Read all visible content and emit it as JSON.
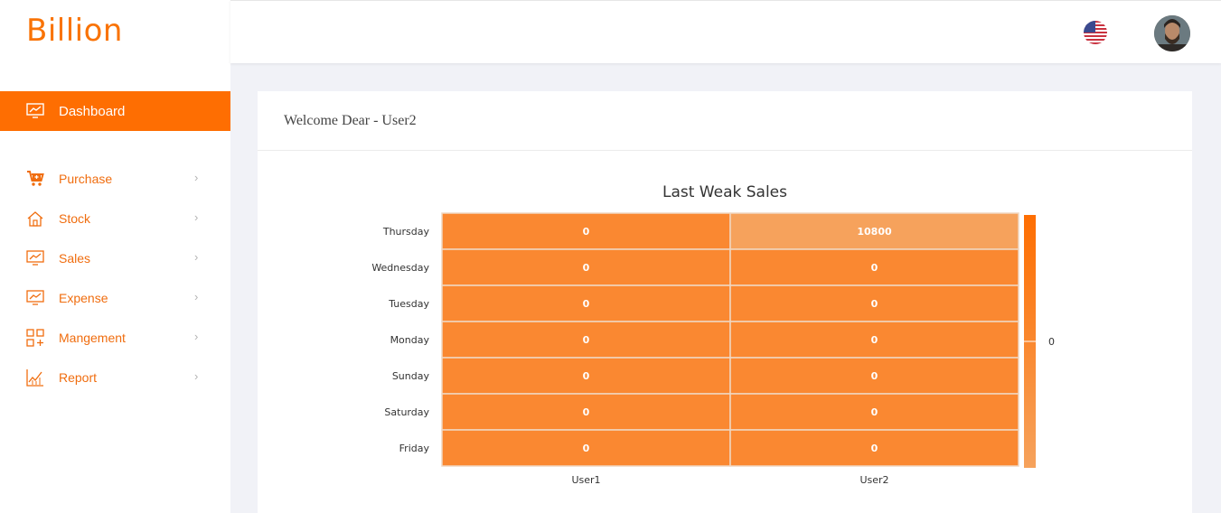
{
  "app": {
    "logo_text": "Billion",
    "brand_color": "#fe6e02"
  },
  "sidebar": {
    "active": {
      "label": "Dashboard",
      "icon": "monitor-chart-icon"
    },
    "items": [
      {
        "label": "Purchase",
        "icon": "cart-plus-icon"
      },
      {
        "label": "Stock",
        "icon": "home-icon"
      },
      {
        "label": "Sales",
        "icon": "monitor-chart-icon"
      },
      {
        "label": "Expense",
        "icon": "monitor-chart-icon"
      },
      {
        "label": "Mangement",
        "icon": "grid-plus-icon"
      },
      {
        "label": "Report",
        "icon": "line-chart-icon"
      }
    ]
  },
  "header": {
    "language_icon": "us-flag-icon",
    "avatar_icon": "user-avatar"
  },
  "card": {
    "welcome": "Welcome Dear - User2"
  },
  "chart_data": {
    "type": "heatmap",
    "title": "Last Weak Sales",
    "x": [
      "User1",
      "User2"
    ],
    "y": [
      "Thursday",
      "Wednesday",
      "Tuesday",
      "Monday",
      "Sunday",
      "Saturday",
      "Friday"
    ],
    "values": [
      [
        0,
        10800
      ],
      [
        0,
        0
      ],
      [
        0,
        0
      ],
      [
        0,
        0
      ],
      [
        0,
        0
      ],
      [
        0,
        0
      ],
      [
        0,
        0
      ]
    ],
    "colorbar_ticks": [
      "0"
    ],
    "colors": {
      "low": "#f6a25c",
      "zero": "#fa8831",
      "high": "#fe6e02"
    }
  }
}
